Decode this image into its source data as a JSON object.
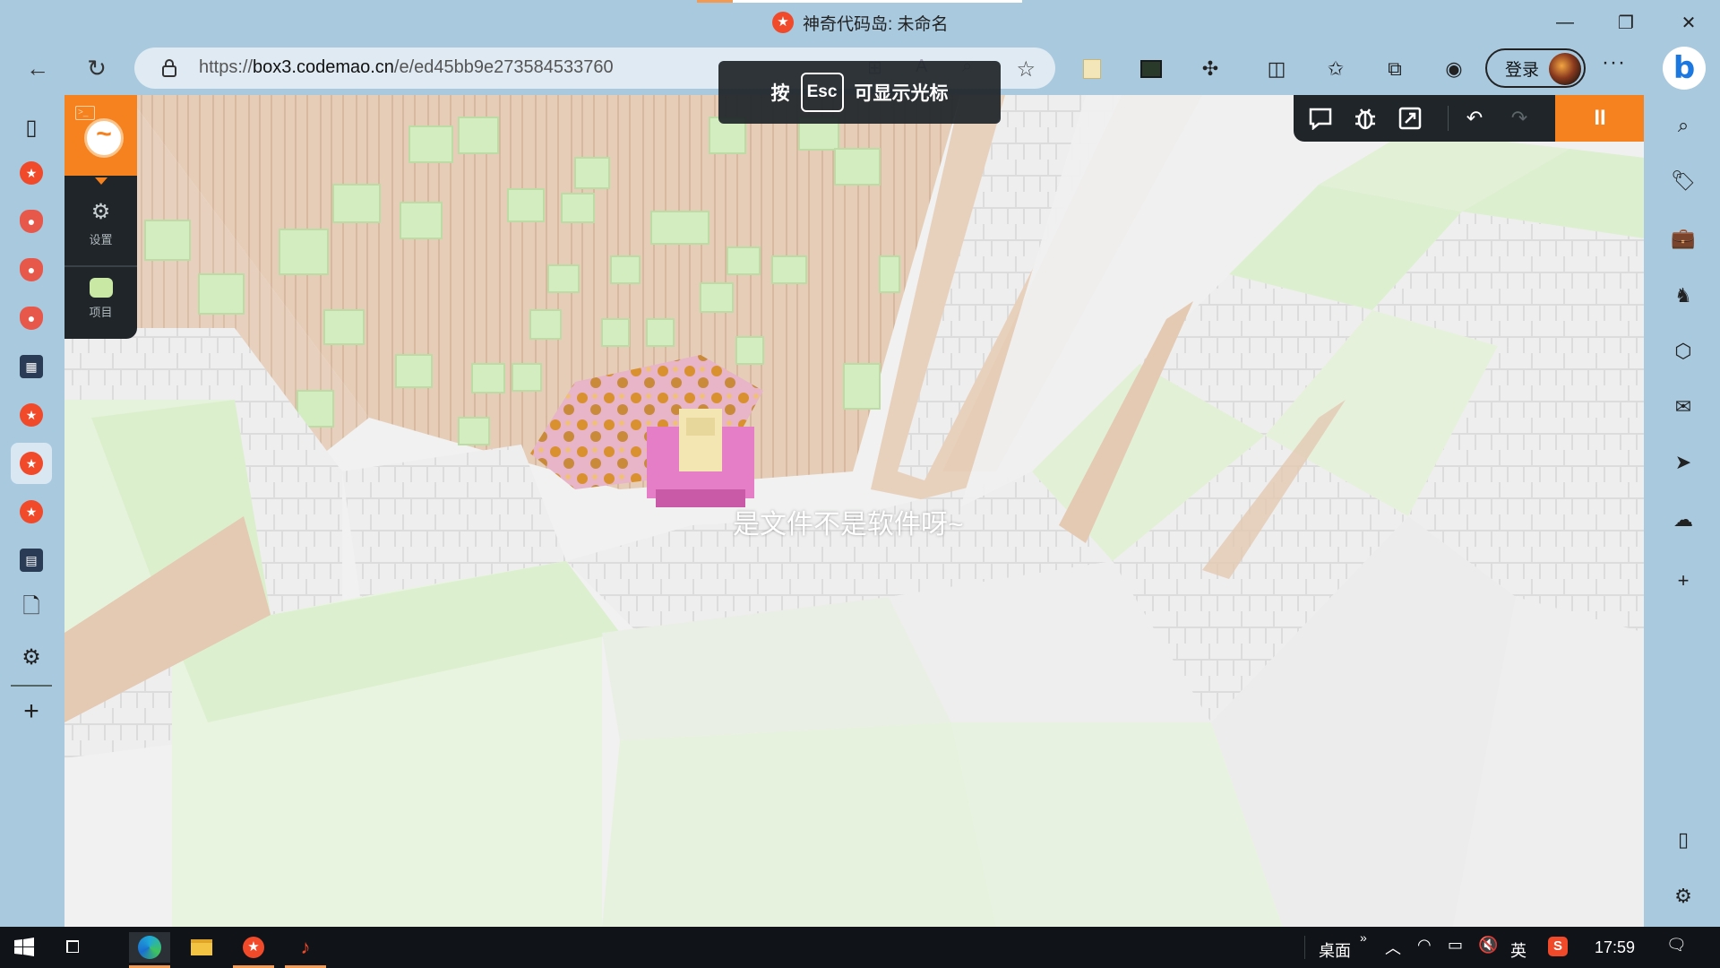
{
  "window": {
    "title": "神奇代码岛: 未命名"
  },
  "browser": {
    "url_scheme": "https://",
    "url_host": "box3.codemao.cn",
    "url_path": "/e/ed45bb9e273584533760",
    "login_label": "登录",
    "more_label": "···",
    "bing_label": "b"
  },
  "left_tabs": [
    {
      "name": "tab-actions-icon",
      "glyph": "▯",
      "style": "ico-line"
    },
    {
      "name": "codemao-tab-1",
      "glyph": "★",
      "style": "ico-red"
    },
    {
      "name": "bird-tab-1",
      "glyph": "●",
      "style": "ico-bird"
    },
    {
      "name": "bird-tab-2",
      "glyph": "●",
      "style": "ico-bird"
    },
    {
      "name": "bird-tab-3",
      "glyph": "●",
      "style": "ico-bird"
    },
    {
      "name": "game-tab",
      "glyph": "▦",
      "style": "ico-dark"
    },
    {
      "name": "codemao-tab-2",
      "glyph": "★",
      "style": "ico-red"
    },
    {
      "name": "codemao-tab-3",
      "glyph": "★",
      "style": "ico-red",
      "active": true
    },
    {
      "name": "codemao-tab-4",
      "glyph": "★",
      "style": "ico-red"
    },
    {
      "name": "book-tab",
      "glyph": "▤",
      "style": "ico-dark"
    },
    {
      "name": "document-tab",
      "glyph": "🗋",
      "style": "ico-line"
    },
    {
      "name": "settings-tab",
      "glyph": "⚙",
      "style": "ico-line"
    }
  ],
  "game": {
    "menu_settings_label": "设置",
    "menu_project_label": "项目",
    "esc_hint_before": "按",
    "esc_hint_key": "Esc",
    "esc_hint_after": "可显示光标",
    "speech_text": "是文件不是软件呀~",
    "pause_label": "II"
  },
  "taskbar": {
    "desktop_label": "桌面",
    "ime_label": "英",
    "time": "17:59"
  }
}
